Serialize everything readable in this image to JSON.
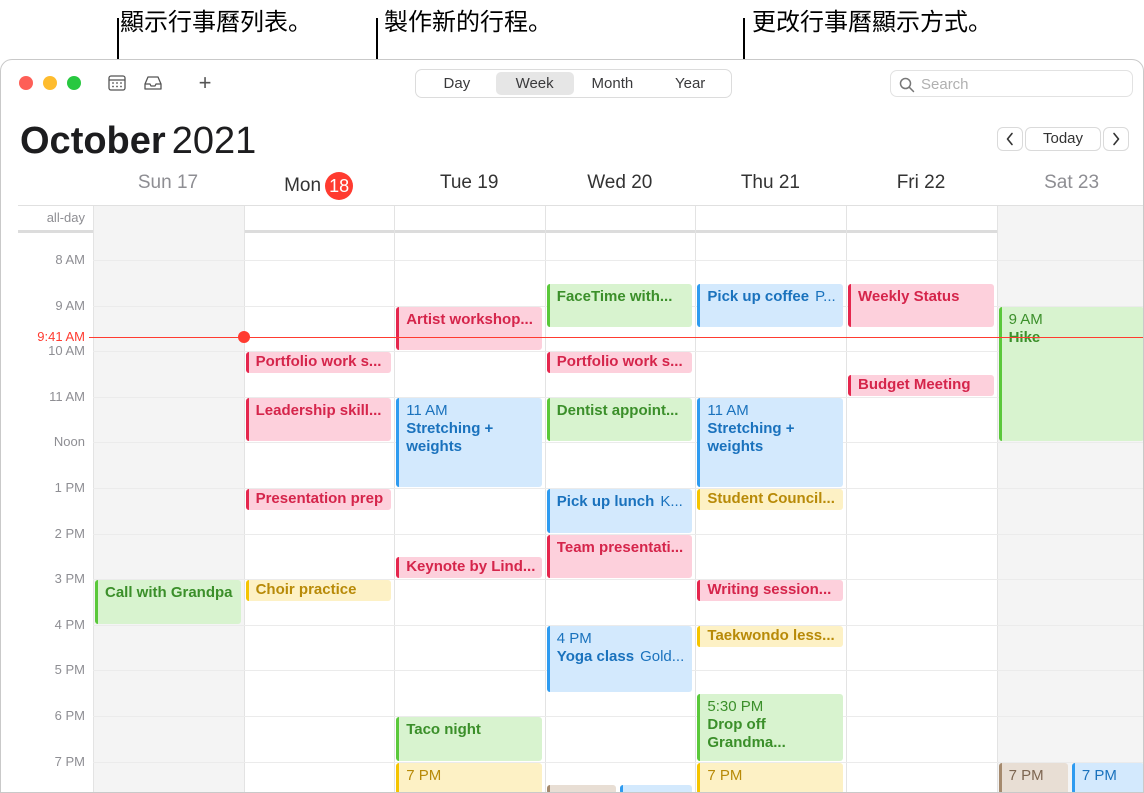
{
  "callouts": {
    "calendar_list": "顯示行事曆列表。",
    "new_event": "製作新的行程。",
    "change_view": "更改行事曆顯示方式。"
  },
  "toolbar": {
    "views": [
      "Day",
      "Week",
      "Month",
      "Year"
    ],
    "active_view": "Week",
    "search_placeholder": "Search",
    "add_label": "+"
  },
  "header": {
    "month": "October",
    "year": "2021",
    "today_label": "Today",
    "prev_icon": "chevron-left-icon",
    "next_icon": "chevron-right-icon"
  },
  "days": [
    {
      "label": "Sun 17",
      "weekend": true
    },
    {
      "label": "Mon",
      "badge": "18",
      "today": true
    },
    {
      "label": "Tue 19"
    },
    {
      "label": "Wed 20"
    },
    {
      "label": "Thu 21"
    },
    {
      "label": "Fri 22"
    },
    {
      "label": "Sat 23",
      "weekend": true
    }
  ],
  "allday_label": "all-day",
  "time_labels": [
    "8 AM",
    "9 AM",
    "10 AM",
    "11 AM",
    "Noon",
    "1 PM",
    "2 PM",
    "3 PM",
    "4 PM",
    "5 PM",
    "6 PM",
    "7 PM"
  ],
  "now_label": "9:41 AM",
  "colors": {
    "today": "#ff3b30",
    "pink": "#e5264d",
    "green": "#5ac83a",
    "blue": "#2e9bf0",
    "yellow": "#f5c400",
    "brown": "#a58a6e"
  },
  "events": [
    {
      "day": 0,
      "start": 15.0,
      "end": 16.0,
      "color": "green",
      "title": "Call with Grandpa"
    },
    {
      "day": 1,
      "start": 10.0,
      "end": 10.5,
      "color": "pink",
      "title": "Portfolio work s..."
    },
    {
      "day": 1,
      "start": 11.0,
      "end": 12.0,
      "color": "pink",
      "title": "Leadership skill..."
    },
    {
      "day": 1,
      "start": 13.0,
      "end": 13.5,
      "color": "pink",
      "title": "Presentation prep"
    },
    {
      "day": 1,
      "start": 15.0,
      "end": 15.5,
      "color": "yellow",
      "title": "Choir practice"
    },
    {
      "day": 2,
      "start": 9.0,
      "end": 10.0,
      "color": "pink",
      "title": "Artist workshop..."
    },
    {
      "day": 2,
      "start": 11.0,
      "end": 13.0,
      "color": "blue",
      "time": "11 AM",
      "title": "Stretching + weights",
      "wrap": true
    },
    {
      "day": 2,
      "start": 14.5,
      "end": 15.0,
      "color": "pink",
      "title": "Keynote by Lind..."
    },
    {
      "day": 2,
      "start": 18.0,
      "end": 19.0,
      "color": "green",
      "title": "Taco night"
    },
    {
      "day": 2,
      "start": 19.0,
      "end": 20.0,
      "color": "yellow",
      "time": "7 PM",
      "title": ""
    },
    {
      "day": 3,
      "start": 8.5,
      "end": 9.5,
      "color": "green",
      "title": "FaceTime with..."
    },
    {
      "day": 3,
      "start": 10.0,
      "end": 10.5,
      "color": "pink",
      "title": "Portfolio work s..."
    },
    {
      "day": 3,
      "start": 11.0,
      "end": 12.0,
      "color": "green",
      "title": "Dentist appoint..."
    },
    {
      "day": 3,
      "start": 13.0,
      "end": 14.0,
      "color": "blue",
      "title": "Pick up lunch",
      "loc": "K..."
    },
    {
      "day": 3,
      "start": 14.0,
      "end": 15.0,
      "color": "pink",
      "title": "Team presentati..."
    },
    {
      "day": 3,
      "start": 16.0,
      "end": 17.5,
      "color": "blue",
      "time": "4 PM",
      "title": "Yoga class",
      "loc": "Gold..."
    },
    {
      "day": 3,
      "start": 19.5,
      "end": 20.5,
      "color": "brown",
      "title": "",
      "width": 0.48
    },
    {
      "day": 3,
      "start": 19.5,
      "end": 20.5,
      "color": "blue",
      "title": "",
      "offset": 0.5,
      "width": 0.5
    },
    {
      "day": 4,
      "start": 8.5,
      "end": 9.5,
      "color": "blue",
      "title": "Pick up coffee",
      "loc": "P..."
    },
    {
      "day": 4,
      "start": 11.0,
      "end": 13.0,
      "color": "blue",
      "time": "11 AM",
      "title": "Stretching + weights",
      "wrap": true
    },
    {
      "day": 4,
      "start": 13.0,
      "end": 13.5,
      "color": "yellow",
      "title": "Student Council..."
    },
    {
      "day": 4,
      "start": 15.0,
      "end": 15.5,
      "color": "pink",
      "title": "Writing session..."
    },
    {
      "day": 4,
      "start": 16.0,
      "end": 16.5,
      "color": "yellow",
      "title": "Taekwondo less..."
    },
    {
      "day": 4,
      "start": 17.5,
      "end": 19.0,
      "color": "green",
      "time": "5:30 PM",
      "title": "Drop off Grandma...",
      "wrap": true
    },
    {
      "day": 4,
      "start": 19.0,
      "end": 20.0,
      "color": "yellow",
      "time": "7 PM",
      "title": ""
    },
    {
      "day": 5,
      "start": 8.5,
      "end": 9.5,
      "color": "pink",
      "title": "Weekly Status"
    },
    {
      "day": 5,
      "start": 10.5,
      "end": 11.0,
      "color": "pink",
      "title": "Budget Meeting"
    },
    {
      "day": 6,
      "start": 9.0,
      "end": 12.0,
      "color": "green",
      "time": "9 AM",
      "title": "Hike"
    },
    {
      "day": 6,
      "start": 19.0,
      "end": 20.0,
      "color": "brown",
      "time": "7 PM",
      "title": "",
      "width": 0.48
    },
    {
      "day": 6,
      "start": 19.0,
      "end": 20.0,
      "color": "blue",
      "time": "7 PM",
      "title": "",
      "offset": 0.5,
      "width": 0.5
    }
  ]
}
